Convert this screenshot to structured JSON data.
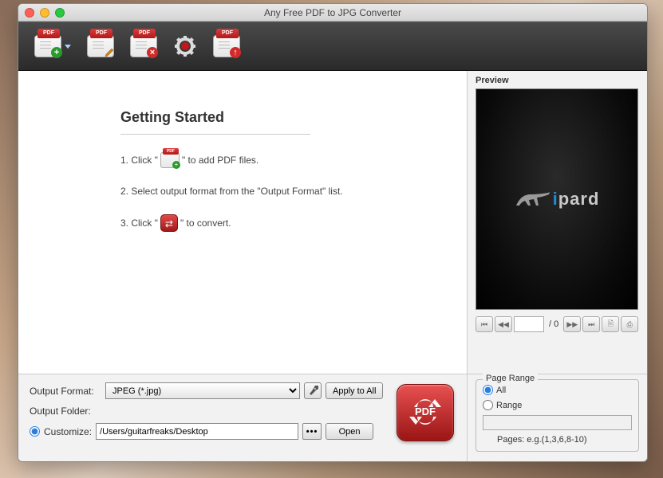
{
  "window": {
    "title": "Any Free PDF to JPG Converter"
  },
  "toolbar": {
    "pdf_label": "PDF"
  },
  "getting_started": {
    "title": "Getting Started",
    "step1_a": "1. Click \"",
    "step1_b": "\" to add PDF files.",
    "step2": "2. Select output format from the \"Output Format\" list.",
    "step3_a": "3. Click \"",
    "step3_b": "\" to convert."
  },
  "preview": {
    "label": "Preview",
    "logo_i": "i",
    "logo_rest": "pard",
    "page_total": "/ 0",
    "page_input": ""
  },
  "output": {
    "format_label": "Output Format:",
    "format_value": "JPEG (*.jpg)",
    "apply_label": "Apply to All",
    "folder_label": "Output Folder:",
    "customize_label": "Customize:",
    "path": "/Users/guitarfreaks/Desktop",
    "browse_label": "•••",
    "open_label": "Open"
  },
  "page_range": {
    "legend": "Page Range",
    "all_label": "All",
    "range_label": "Range",
    "range_value": "",
    "pages_hint": "Pages: e.g.(1,3,6,8-10)"
  },
  "convert": {
    "label": "PDF"
  }
}
